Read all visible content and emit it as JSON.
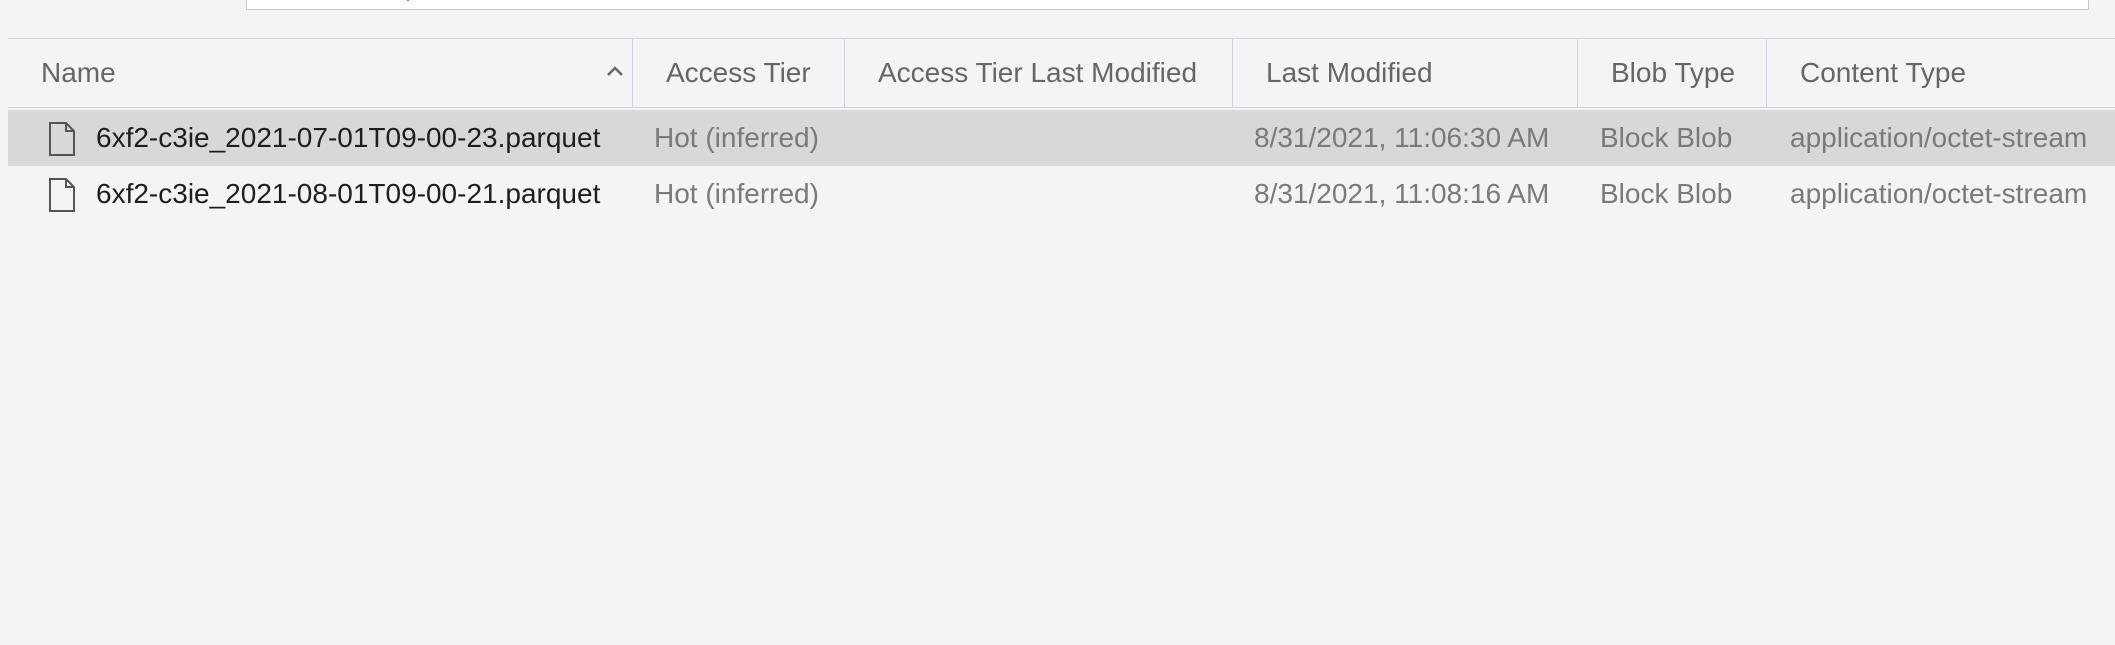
{
  "toolbar": {
    "address_value": ""
  },
  "columns": [
    {
      "label": "Name",
      "sort": "ascending"
    },
    {
      "label": "Access Tier"
    },
    {
      "label": "Access Tier Last Modified"
    },
    {
      "label": "Last Modified"
    },
    {
      "label": "Blob Type"
    },
    {
      "label": "Content Type"
    }
  ],
  "rows": [
    {
      "name": "6xf2-c3ie_2021-07-01T09-00-23.parquet",
      "access_tier": "Hot (inferred)",
      "access_tier_last_modified": "",
      "last_modified": "8/31/2021, 11:06:30 AM",
      "blob_type": "Block Blob",
      "content_type": "application/octet-stream",
      "icon": "file-icon",
      "selected": true
    },
    {
      "name": "6xf2-c3ie_2021-08-01T09-00-21.parquet",
      "access_tier": "Hot (inferred)",
      "access_tier_last_modified": "",
      "last_modified": "8/31/2021, 11:08:16 AM",
      "blob_type": "Block Blob",
      "content_type": "application/octet-stream",
      "icon": "file-icon",
      "selected": false
    }
  ],
  "colors": {
    "background": "#f4f4f4",
    "selected_row": "#d8d8d8",
    "header_text": "#666666",
    "name_text": "#1e1e1e",
    "cell_text": "#7a7a7a",
    "separator": "#cfd3df"
  }
}
